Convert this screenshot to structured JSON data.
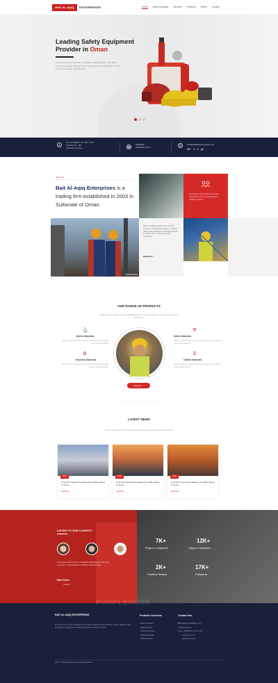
{
  "nav": {
    "logo_box": "BAIT AL-AQIQ",
    "logo_text": "ENTERPRISES",
    "items": [
      "Home",
      "About Company",
      "Services",
      "Products",
      "Career",
      "Contact"
    ]
  },
  "hero": {
    "title_line1": "Leading Safety Equipment",
    "title_line2": "Provider in",
    "title_highlight": "Oman",
    "subtitle": "Lorem ipsum dolor sit amet, consectetur adipisicing elit. Sed diam nonummy in ipsum laoreet dolore magna aliquam erat volutpat. Lorem ipsum consectetur adipiscing elit."
  },
  "contact_bar": {
    "address": [
      "C.R. 1279086/1",
      "P.O. Box: 1725",
      "Postal Code : 115",
      "Sultanate of Oman."
    ],
    "phones": [
      "99999999",
      "24000000 ( FAX )"
    ],
    "email": "info@baitalaqiqenterprises.com",
    "social": [
      "G+",
      "f",
      "t",
      "yt"
    ]
  },
  "about": {
    "tag": "About Us",
    "title_bold": "Bait Al-Aqiq Enterprises",
    "title_rest": " is a trading firm established in 2003 in Sultanate of Oman.",
    "red_card_text": "Lorem ipsum dolor sit amet, consectetur adipiscing elit, sed do eiusmod tempor incididunt ut labore.",
    "grey_card_text": "BAIT AL-AQIQ Enterprises has served the industry by providing quality Marine, Industrial, Oilfield, Safety Materials and Building Materials to a large number of Oman's premium businesses.",
    "read_more": "Readmore",
    "img_caption": "PURPLENODE"
  },
  "products": {
    "title": "OUR RANGE OF PRODUCTS",
    "desc": "A large variety of Marine & Industrial Materials for the Oil & Gas industry, Construction and Safety Equipment",
    "items": [
      {
        "title": "Marine Materials",
        "desc": "BAIT AL-AQIQ Enterprises has served the industry by providing quality Marine Materials"
      },
      {
        "title": "Safety Materials",
        "desc": "BAIT AL-AQIQ Enterprises has served the industry by providing quality Safety Materials"
      },
      {
        "title": "Industrial Materials",
        "desc": "BAIT AL-AQIQ Enterprises has served the industry by providing quality Industrial Materials"
      },
      {
        "title": "Oilfield Materials",
        "desc": "BAIT AL-AQIQ Enterprises has served the industry by providing quality Oilfield Materials"
      }
    ],
    "button": "View all",
    "faint_text": "PURPLENODE"
  },
  "news": {
    "title": "LATEST NEWS",
    "desc": "A Lorem ipsum dolor sit amet, consectetur adipiscing elit. Lorem ipsum dolor sit amet.",
    "items": [
      {
        "date": "MAR",
        "title": "Long Don't Spend Time Beating On A Wall, Hoping To Trans...",
        "more": "Read More"
      },
      {
        "date": "MAR",
        "title": "Long Don't Spend Time Beating On A Wall, Hoping To Trans...",
        "more": "Read More"
      },
      {
        "date": "MAR",
        "title": "Long Don't Spend Time Beating On A Wall, Hoping To Trans...",
        "more": "Read More"
      }
    ]
  },
  "testimonials": {
    "title": "LISTEN TO OUR CLIENTS !",
    "quote": "Lorem ipsum dolor sit amet, consectetur adipiscing elit. Duis aute irure dolor in reprehenderit in voluptate velit esse cillum.",
    "author": "Mark Parker",
    "role": "Customer"
  },
  "stats": [
    {
      "num": "7K+",
      "label": "Project Completed"
    },
    {
      "num": "12K+",
      "label": "Happy Customers"
    },
    {
      "num": "2K+",
      "label": "Positive Review"
    },
    {
      "num": "17K+",
      "label": "Followers"
    }
  ],
  "footer": {
    "logo": "BAIT AL-AQIQ ENTERPRISES",
    "about_text": "We source the very best materials from reputable companies and a marketing company. BAIT AL-AQIQ Enterprises is a trading firm established in 2003 in Sultanate of Oman.",
    "products_title": "Products Overview",
    "products": [
      "Marine Materials",
      "Safety Materials",
      "Industrial Materials",
      "Building Materials",
      "Oilfield Materials"
    ],
    "contact_title": "Contact Info",
    "contact": [
      "24000000, 99999999 ( FAX )",
      "info@email.com",
      "C.R. 1279086/1   P.O. Box: 1725",
      "Postal Code: 115",
      "Sultanate of Oman."
    ],
    "faint": "PURPLENODE",
    "copyright": "2018 © Copyright Bait Al-Aqiq. All Rights Reserved."
  },
  "colors": {
    "accent": "#c8211f",
    "navy": "#18203a"
  }
}
